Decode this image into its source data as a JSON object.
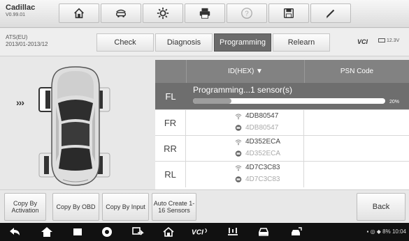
{
  "vehicle": {
    "name": "Cadillac",
    "version": "V0.99.01"
  },
  "toolbar": {
    "items": [
      {
        "icon": "home-icon",
        "enabled": true
      },
      {
        "icon": "vehicle-swap-icon",
        "enabled": true
      },
      {
        "icon": "settings-icon",
        "enabled": true
      },
      {
        "icon": "print-icon",
        "enabled": true
      },
      {
        "icon": "help-icon",
        "enabled": false
      },
      {
        "icon": "save-icon",
        "enabled": true
      },
      {
        "icon": "edit-icon",
        "enabled": true
      }
    ]
  },
  "model": {
    "line1": "ATS(EU)",
    "line2": "2013/01-2013/12"
  },
  "tabs": [
    {
      "label": "Check",
      "active": false
    },
    {
      "label": "Diagnosis",
      "active": false
    },
    {
      "label": "Programming",
      "active": true
    },
    {
      "label": "Relearn",
      "active": false
    }
  ],
  "vci_label": "VCI",
  "battery": "12.3V",
  "table": {
    "col_id": "ID(HEX) ▼",
    "col_psn": "PSN Code",
    "fl": {
      "label": "FL",
      "status": "Programming...1 sensor(s)",
      "progress_label": "20%",
      "progress": 0.2
    },
    "rows": [
      {
        "label": "FR",
        "id": "4DB80547",
        "id2": "4DB80547"
      },
      {
        "label": "RR",
        "id": "4D352ECA",
        "id2": "4D352ECA"
      },
      {
        "label": "RL",
        "id": "4D7C3C83",
        "id2": "4D7C3C83"
      }
    ]
  },
  "bottom": {
    "copy_activation": "Copy By Activation",
    "copy_obd": "Copy By OBD",
    "copy_input": "Copy By Input",
    "auto_create": "Auto Create 1-16 Sensors",
    "back": "Back"
  },
  "nav": {
    "status_time": "10:04",
    "status_battery": "8%"
  },
  "colors": {
    "active_tab": "#6b6b6b",
    "header": "#828282",
    "fl_row": "#6e6e6e"
  }
}
